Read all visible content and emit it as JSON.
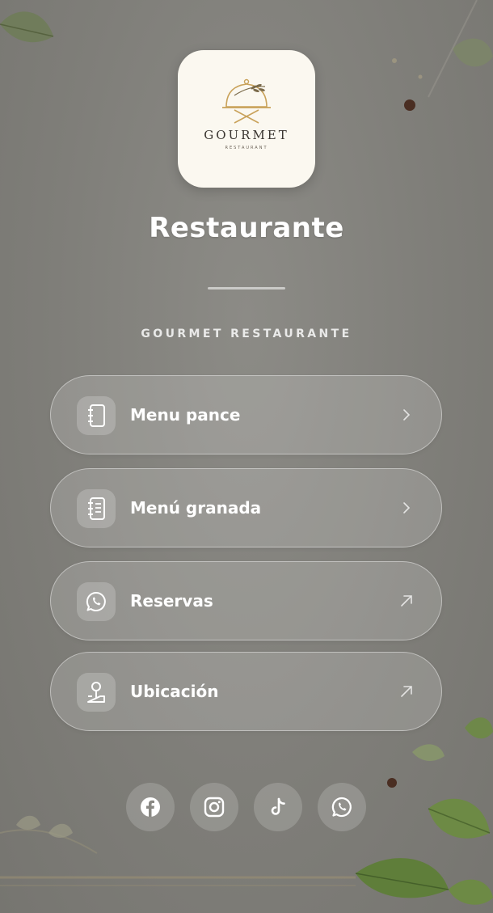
{
  "header": {
    "logo_wordmark": "GOURMET",
    "logo_subtext": "RESTAURANT",
    "title": "Restaurante",
    "subtitle": "GOURMET RESTAURANTE"
  },
  "links": [
    {
      "label": "Menu pance",
      "icon": "notebook-icon",
      "arrow": "chevron-right-icon"
    },
    {
      "label": "Menú granada",
      "icon": "menu-list-icon",
      "arrow": "chevron-right-icon"
    },
    {
      "label": "Reservas",
      "icon": "whatsapp-icon",
      "arrow": "external-arrow-icon"
    },
    {
      "label": "Ubicación",
      "icon": "map-pin-icon",
      "arrow": "external-arrow-icon"
    }
  ],
  "socials": [
    {
      "icon": "facebook-icon"
    },
    {
      "icon": "instagram-icon"
    },
    {
      "icon": "tiktok-icon"
    },
    {
      "icon": "whatsapp-icon"
    }
  ],
  "colors": {
    "background": "#7f7e79",
    "logo_bg": "#fbf8f0",
    "logo_gold": "#c9a25a",
    "text": "#ffffff"
  }
}
